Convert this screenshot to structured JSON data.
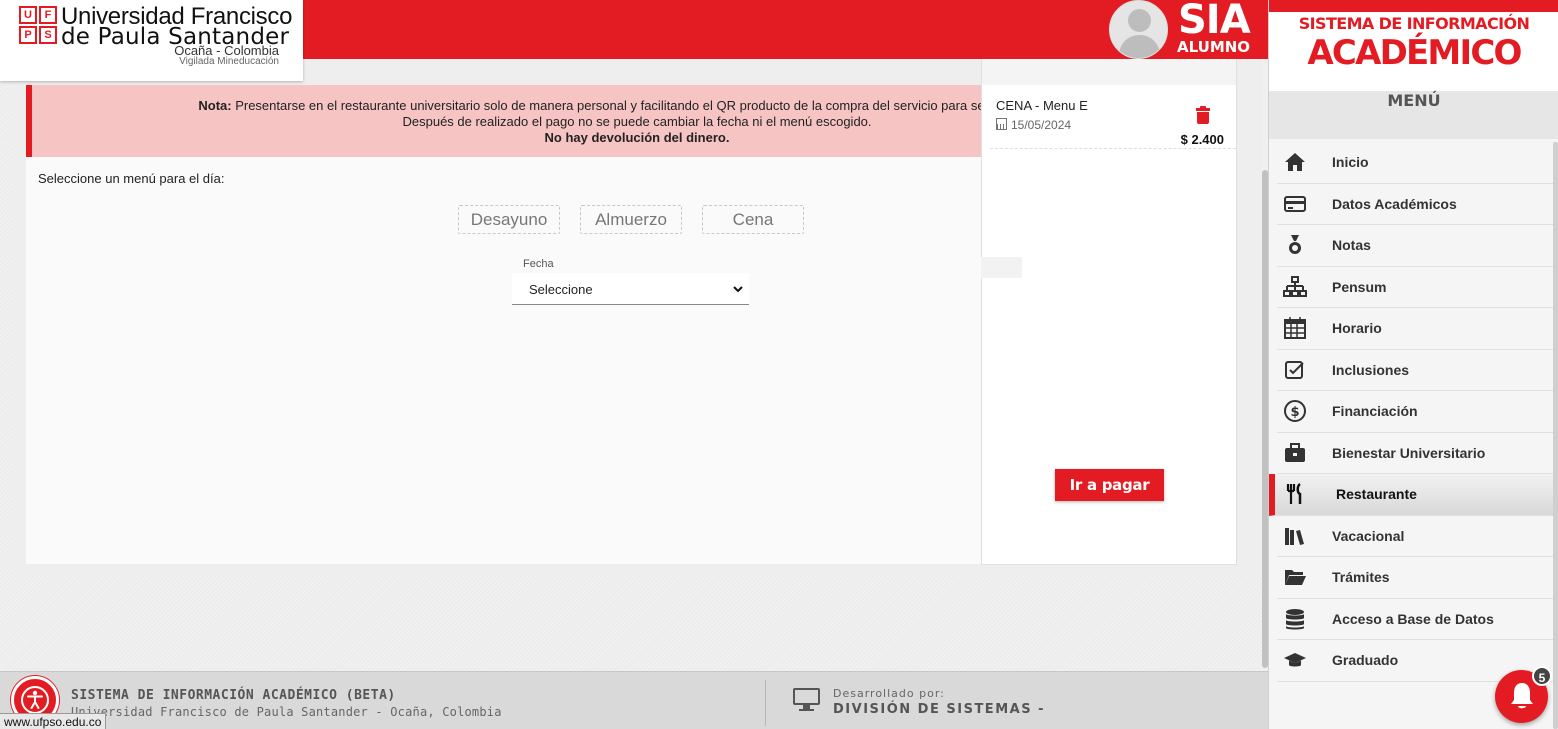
{
  "header": {
    "logo_mark": [
      "U",
      "F",
      "P",
      "S"
    ],
    "university_line1": "Universidad Francisco",
    "university_line2": "de Paula Santander",
    "location": "Ocaña - Colombia",
    "vigilada": "Vigilada Mineducación",
    "app_name": "SIA",
    "role": "ALUMNO"
  },
  "note": {
    "label": "Nota:",
    "line1": " Presentarse en el restaurante universitario solo de manera personal y facilitando el QR producto de la compra del servicio para ser identificados e",
    "line2": "Después de realizado el pago no se puede cambiar la fecha ni el menú escogido.",
    "line3": "No hay devolución del dinero."
  },
  "menu_selector": {
    "prompt": "Seleccione un menú para el día:",
    "meals": [
      "Desayuno",
      "Almuerzo",
      "Cena"
    ],
    "date_label": "Fecha",
    "date_value": "Seleccione"
  },
  "cart": {
    "item_title": "CENA - Menu E",
    "item_date": "15/05/2024",
    "item_price": "$ 2.400",
    "pay_label": "Ir a pagar"
  },
  "footer": {
    "title": "SISTEMA DE INFORMACIÓN ACADÉMICO (BETA)",
    "subtitle": "Universidad Francisco de Paula Santander - Ocaña, Colombia",
    "developed_by_label": "Desarrollado por:",
    "developer": "DIVISIÓN DE SISTEMAS -",
    "status_url": "www.ufpso.edu.co"
  },
  "sidebar": {
    "brand_line1": "SISTEMA DE INFORMACIÓN",
    "brand_line2": "ACADÉMICO",
    "menu_title": "MENÚ",
    "items": [
      {
        "label": "Inicio",
        "icon": "home-icon"
      },
      {
        "label": "Datos Académicos",
        "icon": "card-icon"
      },
      {
        "label": "Notas",
        "icon": "medal-icon"
      },
      {
        "label": "Pensum",
        "icon": "sitemap-icon"
      },
      {
        "label": "Horario",
        "icon": "calendar-icon"
      },
      {
        "label": "Inclusiones",
        "icon": "checkbox-icon"
      },
      {
        "label": "Financiación",
        "icon": "dollar-icon"
      },
      {
        "label": "Bienestar Universitario",
        "icon": "briefcase-icon"
      },
      {
        "label": "Restaurante",
        "icon": "utensils-icon",
        "active": true
      },
      {
        "label": "Vacacional",
        "icon": "books-icon"
      },
      {
        "label": "Trámites",
        "icon": "folder-icon"
      },
      {
        "label": "Acceso a Base de Datos",
        "icon": "database-icon"
      },
      {
        "label": "Graduado",
        "icon": "graduation-cap-icon"
      }
    ]
  },
  "notifications": {
    "count": "5"
  },
  "colors": {
    "brand_red": "#e31c23",
    "note_bg": "#f7c4c4"
  }
}
